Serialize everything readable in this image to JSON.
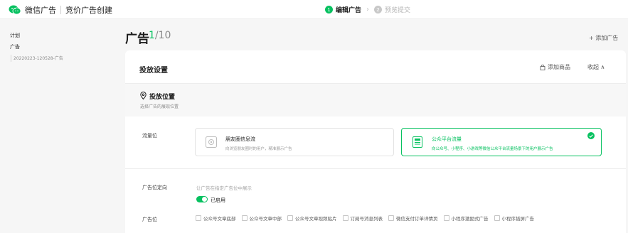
{
  "header": {
    "app_name": "微信广告",
    "page_name": "竞价广告创建",
    "steps": [
      {
        "num": "1",
        "label": "编辑广告",
        "state": "active"
      },
      {
        "num": "2",
        "label": "预览提交",
        "state": "todo"
      }
    ],
    "step_arrow": "›"
  },
  "sidebar": {
    "plan_label": "计划",
    "ad_label": "广告",
    "ad_item": "20220223-120528-广告"
  },
  "main": {
    "title": "广告",
    "count_current": "1",
    "count_total": "/10",
    "add_ad": "+ 添加广告"
  },
  "card": {
    "title": "投放设置",
    "add_product": "添加商品",
    "collapse": "收起 ∧",
    "location": {
      "title": "投放位置",
      "subtitle": "选择广告的展现位置"
    },
    "traffic": {
      "label": "流量位",
      "options": [
        {
          "title": "朋友圈信息流",
          "desc": "向浏览朋友圈时的用户，精准展示广告",
          "selected": false
        },
        {
          "title": "公众平台流量",
          "desc": "向公众号、小程序、小游戏等微信公众平台流量场景下的用户展示广告",
          "selected": true
        }
      ]
    },
    "targeting": {
      "label": "广告位定向",
      "hint": "让广告在指定广告位中展示",
      "toggle_label": "已启用",
      "toggle_on": true
    },
    "positions": {
      "label": "广告位",
      "items": [
        "公众号文章底部",
        "公众号文章中部",
        "公众号文章视频贴片",
        "订阅号消息列表",
        "微信支付订单详情页",
        "小程序激励式广告",
        "小程序插屏广告"
      ]
    }
  },
  "colors": {
    "accent": "#07c160",
    "background": "#f6f6f6",
    "card": "#ffffff"
  }
}
